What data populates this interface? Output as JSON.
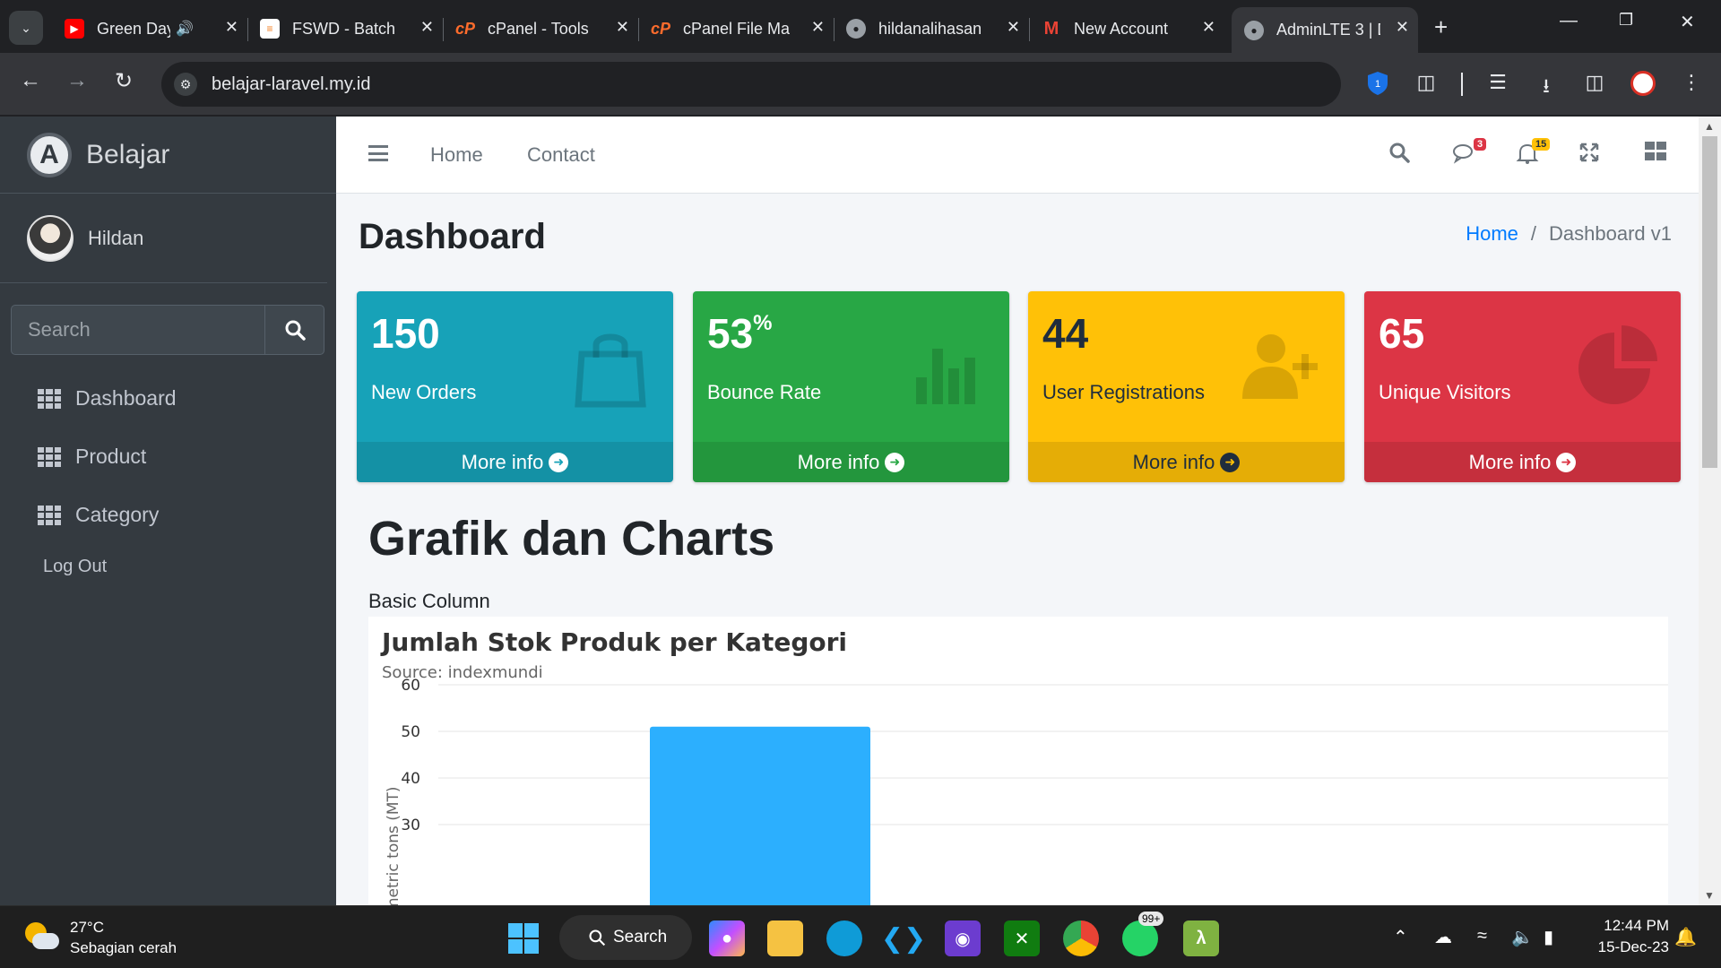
{
  "browser": {
    "tabs": [
      {
        "title": "Green Day",
        "favicon": "youtube-icon",
        "color": "#ff0000"
      },
      {
        "title": "FSWD - Batch",
        "favicon": "stack-icon",
        "color": "#f48024"
      },
      {
        "title": "cPanel - Tools",
        "favicon": "cpanel-icon",
        "color": "#ff6c2c"
      },
      {
        "title": "cPanel File Ma",
        "favicon": "cpanel-icon",
        "color": "#ff6c2c"
      },
      {
        "title": "hildanalihasan",
        "favicon": "globe-icon",
        "color": "#9aa0a6"
      },
      {
        "title": "New Account",
        "favicon": "gmail-icon",
        "color": "#ea4335"
      },
      {
        "title": "AdminLTE 3 | D",
        "favicon": "globe-icon",
        "color": "#9aa0a6"
      }
    ],
    "url": "belajar-laravel.my.id",
    "extension_badge": "1"
  },
  "sidebar": {
    "brand": "Belajar",
    "user": "Hildan",
    "search_placeholder": "Search",
    "menu": [
      {
        "label": "Dashboard"
      },
      {
        "label": "Product"
      },
      {
        "label": "Category"
      }
    ],
    "logout": "Log Out"
  },
  "topnav": {
    "links": [
      "Home",
      "Contact"
    ],
    "messages_badge": "3",
    "notifications_badge": "15"
  },
  "page": {
    "title": "Dashboard",
    "breadcrumb": {
      "home": "Home",
      "sep": "/",
      "current": "Dashboard v1"
    }
  },
  "boxes": [
    {
      "value": "150",
      "suffix": "",
      "label": "New Orders",
      "footer": "More info",
      "color": "#17a2b8",
      "icon": "shopping-bag-icon"
    },
    {
      "value": "53",
      "suffix": "%",
      "label": "Bounce Rate",
      "footer": "More info",
      "color": "#28a745",
      "icon": "bar-chart-icon"
    },
    {
      "value": "44",
      "suffix": "",
      "label": "User Registrations",
      "footer": "More info",
      "color": "#ffc107",
      "icon": "user-plus-icon"
    },
    {
      "value": "65",
      "suffix": "",
      "label": "Unique Visitors",
      "footer": "More info",
      "color": "#dc3545",
      "icon": "pie-chart-icon"
    }
  ],
  "charts_section": {
    "title": "Grafik dan Charts",
    "caption": "Basic Column"
  },
  "chart_data": {
    "type": "bar",
    "title": "Jumlah Stok Produk per Kategori",
    "subtitle": "Source: indexmundi",
    "ylabel": "metric tons (MT)",
    "yticks": [
      60,
      50,
      40,
      30
    ],
    "ylim": [
      30,
      60
    ],
    "values": [
      51
    ],
    "series_color": "#2caffe"
  },
  "taskbar": {
    "weather_temp": "27°C",
    "weather_desc": "Sebagian cerah",
    "search_label": "Search",
    "whatsapp_badge": "99+",
    "time": "12:44 PM",
    "date": "15-Dec-23"
  }
}
